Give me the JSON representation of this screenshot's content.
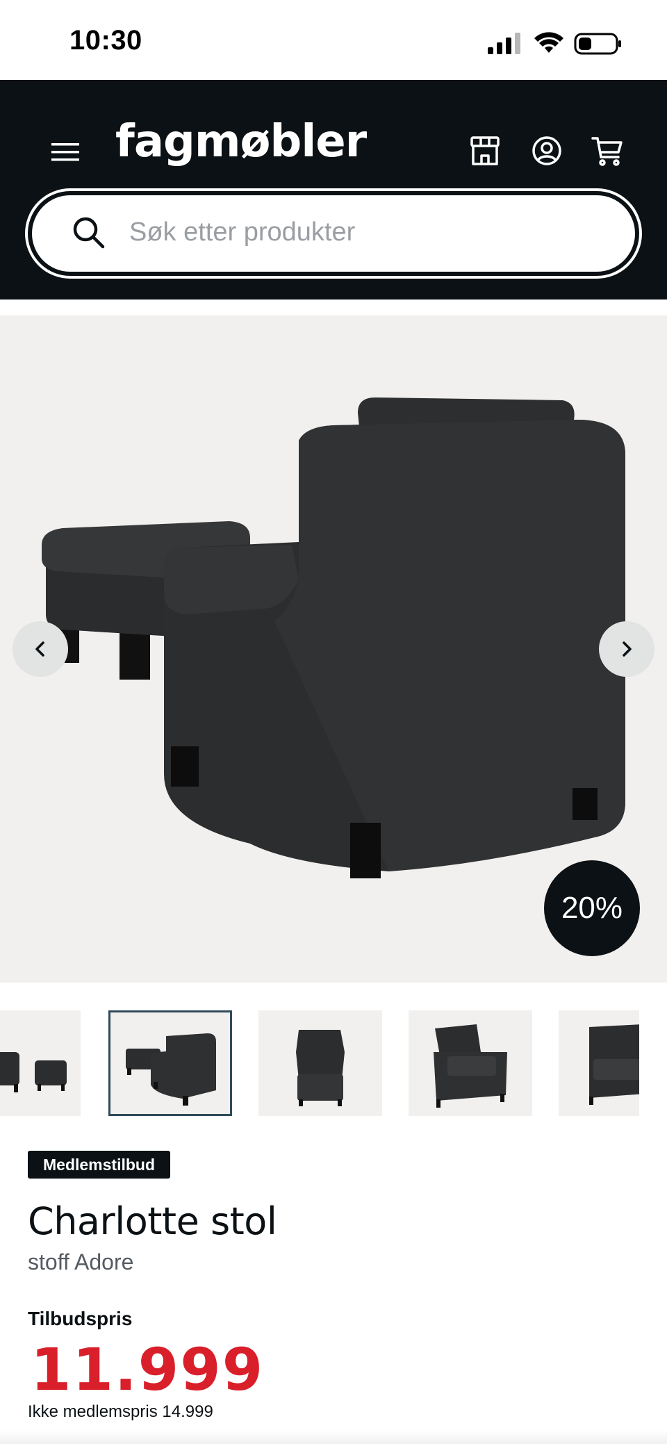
{
  "status_bar": {
    "time": "10:30"
  },
  "header": {
    "logo": "fagmøbler",
    "search": {
      "placeholder": "Søk etter produkter",
      "value": ""
    }
  },
  "gallery": {
    "discount_badge": "20%",
    "active_thumbnail": 2,
    "thumbnail_count": 5
  },
  "product": {
    "badge": "Medlemstilbud",
    "title": "Charlotte stol",
    "subtitle": "stoff Adore",
    "price_label": "Tilbudspris",
    "price": "11.999",
    "non_member_price": "Ikke medlemspris 14.999"
  },
  "colors": {
    "header_bg": "#0b1114",
    "price": "#d81f2a",
    "image_bg": "#f2f0ee",
    "active_thumb_border": "#2f4a5a"
  }
}
